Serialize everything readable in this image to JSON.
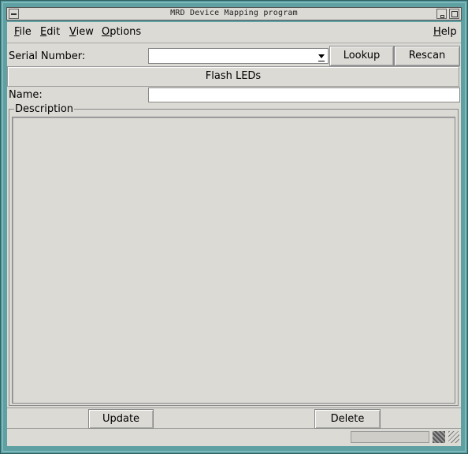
{
  "window": {
    "title": "MRD Device Mapping program"
  },
  "menu": {
    "file": "File",
    "edit": "Edit",
    "view": "View",
    "options": "Options",
    "help": "Help"
  },
  "form": {
    "serial_label": "Serial Number:",
    "serial_value": "",
    "lookup_label": "Lookup",
    "rescan_label": "Rescan",
    "flash_label": "Flash LEDs",
    "name_label": "Name:",
    "name_value": "",
    "description_label": "Description",
    "description_value": ""
  },
  "actions": {
    "update_label": "Update",
    "delete_label": "Delete"
  },
  "icons": [
    "window-menu-icon",
    "minimize-icon",
    "maximize-icon",
    "dropdown-arrow-icon",
    "resize-grip-icon"
  ]
}
